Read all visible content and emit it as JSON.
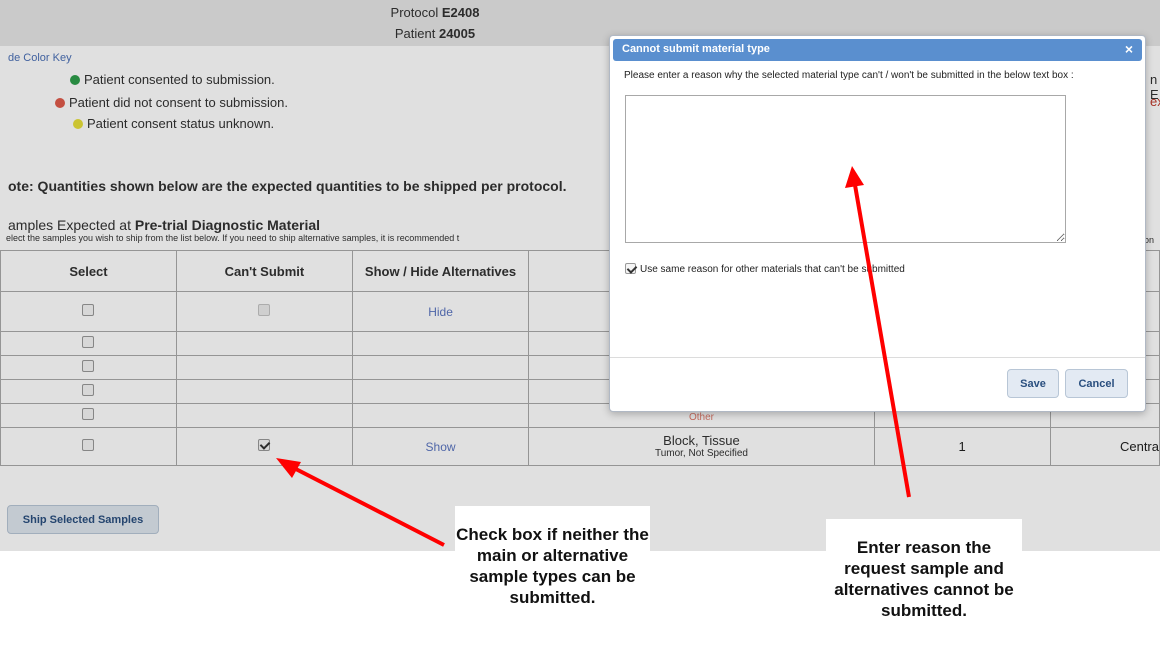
{
  "header": {
    "protocol_label": "Protocol",
    "protocol_value": "E2408",
    "patient_label": "Patient",
    "patient_value": "24005"
  },
  "color_key": {
    "link_label": "de Color Key",
    "items": [
      {
        "text": "Patient consented to submission.",
        "color": "#2e9e4a"
      },
      {
        "text": "Patient did not consent to submission.",
        "color": "#e05a4a"
      },
      {
        "text": "Patient consent status unknown.",
        "color": "#e8e03a"
      }
    ]
  },
  "note": "ote: Quantities shown below are the expected quantities to be shipped per protocol.",
  "samples": {
    "title_prefix": "amples Expected at",
    "title_bold": "Pre-trial Diagnostic Material",
    "subtitle": "elect the samples you wish to ship from the list below. If you need to ship alternative samples, it is recommended t",
    "subtitle_right": "on",
    "right_cut_1": "n E",
    "right_cut_2": "ex"
  },
  "table": {
    "headers": {
      "select": "Select",
      "cant_submit": "Can't Submit",
      "show_hide": "Show / Hide Alternatives"
    },
    "rows": [
      {
        "select": false,
        "cant": "disabled",
        "toggle": "Hide",
        "material": "",
        "material_sub": "",
        "qty": "",
        "dest": ""
      },
      {
        "select": false,
        "cant": "",
        "toggle": "",
        "material": "",
        "material_sub": "",
        "qty": "",
        "dest": ""
      },
      {
        "select": false,
        "cant": "",
        "toggle": "",
        "material": "",
        "material_sub": "",
        "qty": "",
        "dest": ""
      },
      {
        "select": false,
        "cant": "",
        "toggle": "",
        "material": "",
        "material_sub": "",
        "qty": "",
        "dest": ""
      },
      {
        "select": false,
        "cant": "",
        "toggle": "",
        "material": "Other",
        "material_sub": "",
        "qty": "",
        "dest": ""
      },
      {
        "select": false,
        "cant": "checked",
        "toggle": "Show",
        "material": "Block, Tissue",
        "material_sub": "Tumor, Not Specified",
        "qty": "1",
        "dest": "Centra"
      }
    ]
  },
  "ship_button_label": "Ship Selected Samples",
  "modal": {
    "title": "Cannot submit material type",
    "close_glyph": "×",
    "prompt": "Please enter a reason why the selected material type can't / won't be submitted in the below text box :",
    "textarea_value": "",
    "reuse_label": "Use same reason for other materials that can't be submitted",
    "reuse_checked": true,
    "save_label": "Save",
    "cancel_label": "Cancel"
  },
  "callouts": {
    "left": "Check box if neither the main or alternative sample types can be submitted.",
    "right": "Enter reason the request sample and alternatives cannot be submitted."
  },
  "colors": {
    "arrow": "#ff0000",
    "modal_header": "#5a8fcf",
    "button_text": "#2a4f7f"
  }
}
